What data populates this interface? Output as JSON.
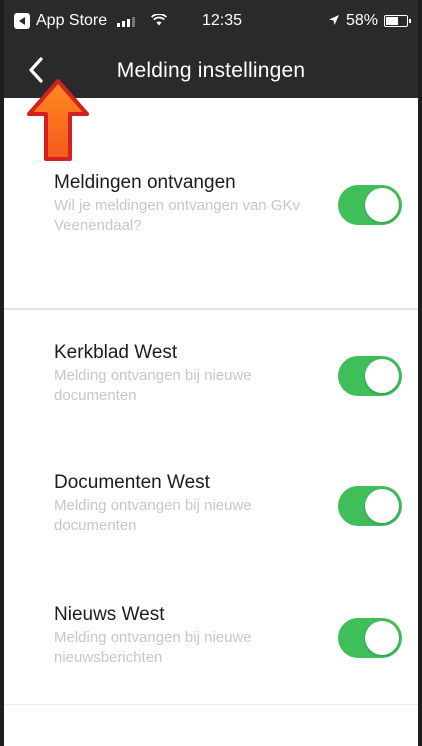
{
  "status_bar": {
    "carrier": "App Store",
    "time": "12:35",
    "battery": "58%"
  },
  "nav": {
    "title": "Melding instellingen"
  },
  "settings": [
    {
      "title": "Meldingen ontvangen",
      "description": "Wil je meldingen ontvangen van GKv Veenendaal?",
      "enabled": true
    },
    {
      "title": "Kerkblad West",
      "description": "Melding ontvangen bij nieuwe documenten",
      "enabled": true
    },
    {
      "title": "Documenten West",
      "description": "Melding ontvangen bij nieuwe documenten",
      "enabled": true
    },
    {
      "title": "Nieuws West",
      "description": "Melding ontvangen bij nieuwe nieuwsberichten",
      "enabled": true
    }
  ],
  "colors": {
    "header_bg": "#2a2a2a",
    "toggle_on": "#3fbe5a",
    "description_text": "#c4c7cc",
    "annotation_arrow": "#f25a1d"
  },
  "icons": {
    "back": "chevron-left-icon",
    "annotation": "up-arrow-icon"
  }
}
